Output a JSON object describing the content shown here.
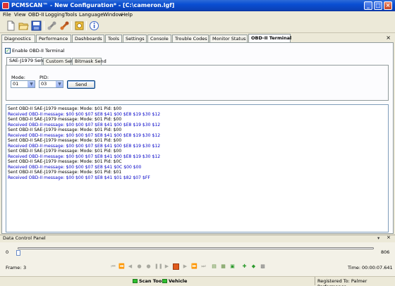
{
  "window": {
    "title": "PCMSCAN™ - New Configuration* - [C:\\cameron.lgf]",
    "buttons": {
      "minimize": "_",
      "maximize": "□",
      "close": "×"
    }
  },
  "menu": [
    "File",
    "View",
    "OBD-II",
    "Logging",
    "Tools",
    "Language",
    "Window",
    "Help"
  ],
  "toolbar": {
    "icons": [
      "new-file-icon",
      "open-folder-icon",
      "save-icon",
      "connect-icon",
      "disconnect-icon",
      "settings-icon",
      "info-icon"
    ]
  },
  "tabs": [
    {
      "label": "Diagnostics"
    },
    {
      "label": "Performance"
    },
    {
      "label": "Dashboards"
    },
    {
      "label": "Tools"
    },
    {
      "label": "Settings"
    },
    {
      "label": "Console"
    },
    {
      "label": "Trouble Codes"
    },
    {
      "label": "Monitor Status"
    },
    {
      "label": "OBD-II Terminal"
    }
  ],
  "terminal": {
    "enable_label": "Enable OBD-II Terminal",
    "enable_checked": true,
    "subtabs": [
      "SAE-J1979 Send",
      "Custom Send",
      "Bitmask Send"
    ],
    "mode_label": "Mode:",
    "mode_value": "01",
    "pid_label": "PID:",
    "pid_value": "03",
    "send_label": "Send"
  },
  "log": [
    {
      "type": "sent",
      "text": "Sent OBD-II SAE-J1979 message: Mode: $01 Pid: $00"
    },
    {
      "type": "recv",
      "text": "Received OBD-II message: $00 $00 $07 $E8 $41 $00 $E8 $19 $30 $12"
    },
    {
      "type": "sent",
      "text": "Sent OBD-II SAE-J1979 message: Mode: $01 Pid: $00"
    },
    {
      "type": "recv",
      "text": "Received OBD-II message: $00 $00 $07 $E8 $41 $00 $E8 $19 $30 $12"
    },
    {
      "type": "sent",
      "text": "Sent OBD-II SAE-J1979 message: Mode: $01 Pid: $00"
    },
    {
      "type": "recv",
      "text": "Received OBD-II message: $00 $00 $07 $E8 $41 $00 $E8 $19 $30 $12"
    },
    {
      "type": "sent",
      "text": "Sent OBD-II SAE-J1979 message: Mode: $01 Pid: $00"
    },
    {
      "type": "recv",
      "text": "Received OBD-II message: $00 $00 $07 $E8 $41 $00 $E8 $19 $30 $12"
    },
    {
      "type": "sent",
      "text": "Sent OBD-II SAE-J1979 message: Mode: $01 Pid: $00"
    },
    {
      "type": "recv",
      "text": "Received OBD-II message: $00 $00 $07 $E8 $41 $00 $E8 $19 $30 $12"
    },
    {
      "type": "sent",
      "text": "Sent OBD-II SAE-J1979 message: Mode: $01 Pid: $0C"
    },
    {
      "type": "recv",
      "text": "Received OBD-II message: $00 $00 $07 $E8 $41 $0C $00 $00"
    },
    {
      "type": "sent",
      "text": "Sent OBD-II SAE-J1979 message: Mode: $01 Pid: $01"
    },
    {
      "type": "recv",
      "text": "Received OBD-II message: $00 $00 $07 $E8 $41 $01 $82 $07 $FF"
    }
  ],
  "data_control_panel": {
    "title": "Data Control Panel",
    "slider_min": "0",
    "slider_max": "806",
    "slider_position": 0,
    "frame_label": "Frame:",
    "frame_value": "3",
    "time_label": "Time:",
    "time_value": "00:00:07.641"
  },
  "status": {
    "scan_tool": "Scan Tool",
    "vehicle": "Vehicle",
    "registered": "Registered To: Palmer Performance"
  },
  "colors": {
    "titlebar": "#0a4fd3",
    "sent_text": "#000000",
    "received_text": "#0000c8",
    "status_ok": "#2fbf2f"
  }
}
